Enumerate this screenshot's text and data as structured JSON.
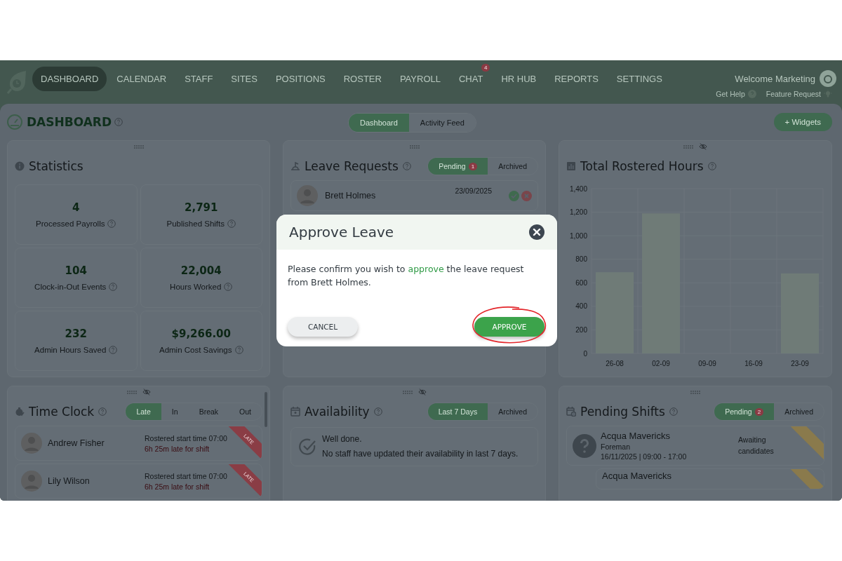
{
  "nav": {
    "items": [
      {
        "label": "DASHBOARD",
        "selected": true
      },
      {
        "label": "CALENDAR",
        "selected": false
      },
      {
        "label": "STAFF",
        "selected": false
      },
      {
        "label": "SITES",
        "selected": false
      },
      {
        "label": "POSITIONS",
        "selected": false
      },
      {
        "label": "ROSTER",
        "selected": false
      },
      {
        "label": "PAYROLL",
        "selected": false
      },
      {
        "label": "CHAT",
        "selected": false,
        "badge": "4"
      },
      {
        "label": "HR HUB",
        "selected": false
      },
      {
        "label": "REPORTS",
        "selected": false
      },
      {
        "label": "SETTINGS",
        "selected": false
      }
    ],
    "welcome": "Welcome Marketing",
    "links": [
      {
        "label": "Get Help",
        "kind": "help"
      },
      {
        "label": "Feature Request",
        "kind": "idea"
      }
    ]
  },
  "page": {
    "title": "DASHBOARD",
    "views": [
      {
        "label": "Dashboard",
        "selected": true
      },
      {
        "label": "Activity Feed",
        "selected": false
      }
    ],
    "add_button": "+ Widgets"
  },
  "widgets": [
    {
      "kind": "statistics",
      "title": "Statistics",
      "help": false,
      "visibility_toggle": false,
      "stats": [
        {
          "value": "4",
          "label": "Processed Payrolls"
        },
        {
          "value": "2,791",
          "label": "Published Shifts"
        },
        {
          "value": "104",
          "label": "Clock-in-Out Events"
        },
        {
          "value": "22,004",
          "label": "Hours Worked"
        },
        {
          "value": "232",
          "label": "Admin Hours Saved"
        },
        {
          "value": "$9,266.00",
          "label": "Admin Cost Savings"
        }
      ]
    },
    {
      "kind": "leave",
      "title": "Leave Requests",
      "help": true,
      "visibility_toggle": false,
      "tabs": [
        {
          "label": "Pending",
          "badge": "1",
          "selected": true
        },
        {
          "label": "Archived",
          "selected": false
        }
      ],
      "requests": [
        {
          "name": "Brett Holmes",
          "date": "23/09/2025"
        }
      ]
    },
    {
      "kind": "chart",
      "title": "Total Rostered Hours",
      "help": true,
      "visibility_toggle": true,
      "chart_data": {
        "type": "bar",
        "categories": [
          "26-08",
          "02-09",
          "09-09",
          "16-09",
          "23-09"
        ],
        "grid": true,
        "series": [
          {
            "color": "#6f7b77",
            "values": [
              690,
              1190,
              0,
              0,
              680
            ]
          }
        ],
        "ylim": [
          0,
          1400
        ],
        "yticks": [
          {
            "value": 0,
            "label": "0"
          },
          {
            "value": 200,
            "label": "200"
          },
          {
            "value": 400,
            "label": "400"
          },
          {
            "value": 600,
            "label": "600"
          },
          {
            "value": 800,
            "label": "800"
          },
          {
            "value": 1000,
            "label": "1,000"
          },
          {
            "value": 1200,
            "label": "1,200"
          },
          {
            "value": 1400,
            "label": "1,400"
          }
        ]
      }
    },
    {
      "kind": "timeclock",
      "title": "Time Clock",
      "help": true,
      "visibility_toggle": true,
      "tabs": [
        {
          "label": "Late",
          "selected": true
        },
        {
          "label": "In",
          "selected": false
        },
        {
          "label": "Break",
          "selected": false
        },
        {
          "label": "Out",
          "selected": false
        }
      ],
      "entries": [
        {
          "name": "Andrew Fisher",
          "rostered": "Rostered start time 07:00",
          "late": "6h 25m late for shift",
          "ribbon": "LATE"
        },
        {
          "name": "Lily Wilson",
          "rostered": "Rostered start time 07:00",
          "late": "6h 25m late for shift",
          "ribbon": "LATE"
        }
      ]
    },
    {
      "kind": "availability",
      "title": "Availability",
      "help": true,
      "visibility_toggle": true,
      "tabs": [
        {
          "label": "Last 7 Days",
          "selected": true
        },
        {
          "label": "Archived",
          "selected": false
        }
      ],
      "message": [
        "Well done.",
        "No staff have updated their availability in last 7 days."
      ]
    },
    {
      "kind": "pending_shifts",
      "title": "Pending Shifts",
      "help": true,
      "visibility_toggle": false,
      "tabs": [
        {
          "label": "Pending",
          "badge": "2",
          "selected": true
        },
        {
          "label": "Archived",
          "selected": false
        }
      ],
      "shifts": [
        {
          "site": "Acqua Mavericks",
          "position": "Foreman",
          "time": "16/11/2025 | 09:00 - 17:00",
          "status": "Awaiting candidates",
          "flagged": true
        },
        {
          "site": "Acqua Mavericks",
          "flagged": true
        }
      ]
    }
  ],
  "dialog": {
    "title": "Approve Leave",
    "message": [
      {
        "text": "Please confirm you wish to ",
        "kind": "plain"
      },
      {
        "text": "approve",
        "kind": "highlight"
      },
      {
        "text": " the leave request from Brett Holmes.",
        "kind": "plain"
      }
    ],
    "buttons": [
      {
        "label": "CANCEL",
        "kind": "secondary",
        "circled": false
      },
      {
        "label": "APPROVE",
        "kind": "primary",
        "circled": true
      }
    ]
  }
}
